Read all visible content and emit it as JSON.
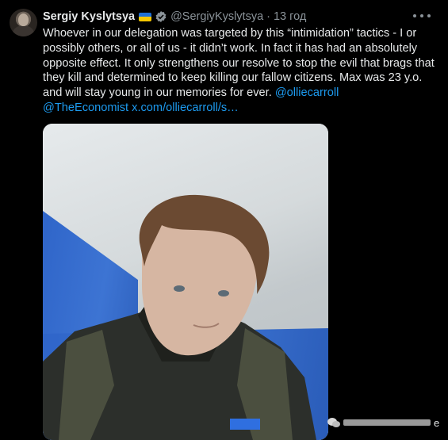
{
  "tweet": {
    "display_name": "Sergiy Kyslytsya",
    "handle": "@SergiyKyslytsya",
    "separator": "·",
    "time": "13 год",
    "text": "Whoever in our delegation was targeted by this “intimidation” tactics - I or possibly others, or all of us - it didn’t work. In fact it has had an absolutely opposite effect. It only strengthens our resolve to stop the evil that brags that they kill and determined to keep killing our fallow citizens. Max was 23 y.o. and will stay young in our memories for ever.",
    "mention": "@olliecarroll",
    "mention2": "@TheEconomist",
    "url": "x.com/olliecarroll/s…",
    "icons": {
      "flag": "ukraine-flag-icon",
      "verified": "verified-badge-icon",
      "more": "more-options-icon"
    },
    "colors": {
      "link": "#1d9bf0",
      "text": "#e7e9ea",
      "muted": "#8b9399",
      "background": "#000000"
    }
  },
  "watermark": {
    "trailing_letter": "e"
  }
}
